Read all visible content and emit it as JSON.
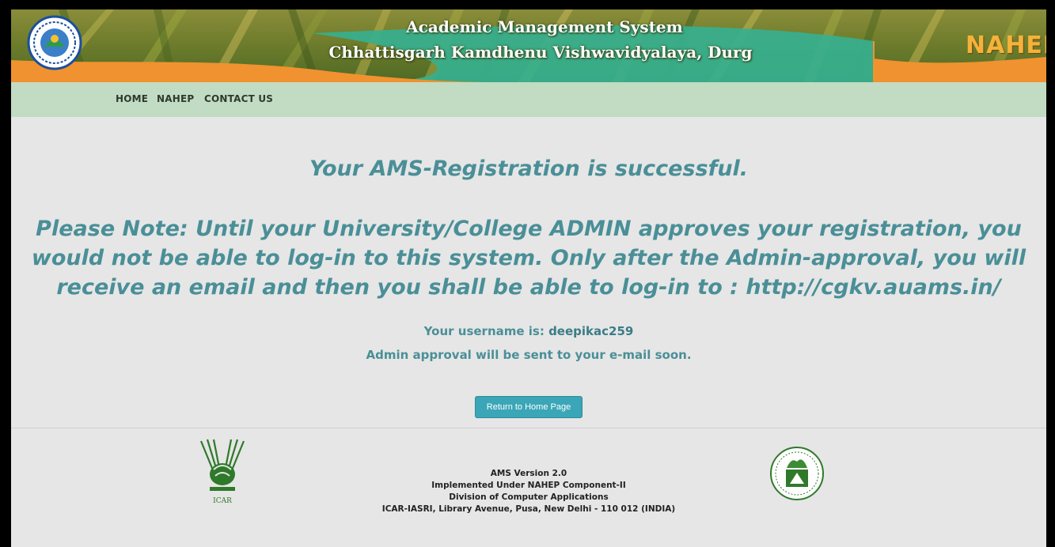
{
  "header": {
    "title_line1": "Academic Management System",
    "title_line2": "Chhattisgarh Kamdhenu Vishwavidyalaya, Durg",
    "right_logo_text": "NAHEP"
  },
  "nav": {
    "items": [
      {
        "label": "HOME"
      },
      {
        "label": "NAHEP"
      },
      {
        "label": "CONTACT US"
      }
    ]
  },
  "main": {
    "success_message": "Your AMS-Registration is successful.",
    "note_label": "Please Note:",
    "note_text": " Until your University/College ADMIN approves your registration, you would not be able to log-in to this system. Only after the Admin-approval, you will receive an email and then you shall be able to log-in to : http://cgkv.auams.in/",
    "username_label": "Your username is: ",
    "username_value": "deepikac259",
    "approval_text": "Admin approval will be sent to your e-mail soon.",
    "return_button_label": "Return to Home Page"
  },
  "footer": {
    "icar_logo_text": "ICAR",
    "lines": [
      "AMS Version 2.0",
      "Implemented Under NAHEP Component-II",
      "Division of Computer Applications",
      "ICAR-IASRI, Library Avenue, Pusa, New Delhi - 110 012 (INDIA)"
    ]
  },
  "colors": {
    "accent_teal": "#4a8f97",
    "nav_bg": "#c2dcc3",
    "button_bg": "#3aa6b7",
    "banner_orange": "#f0922f",
    "banner_green": "#36b08f"
  }
}
